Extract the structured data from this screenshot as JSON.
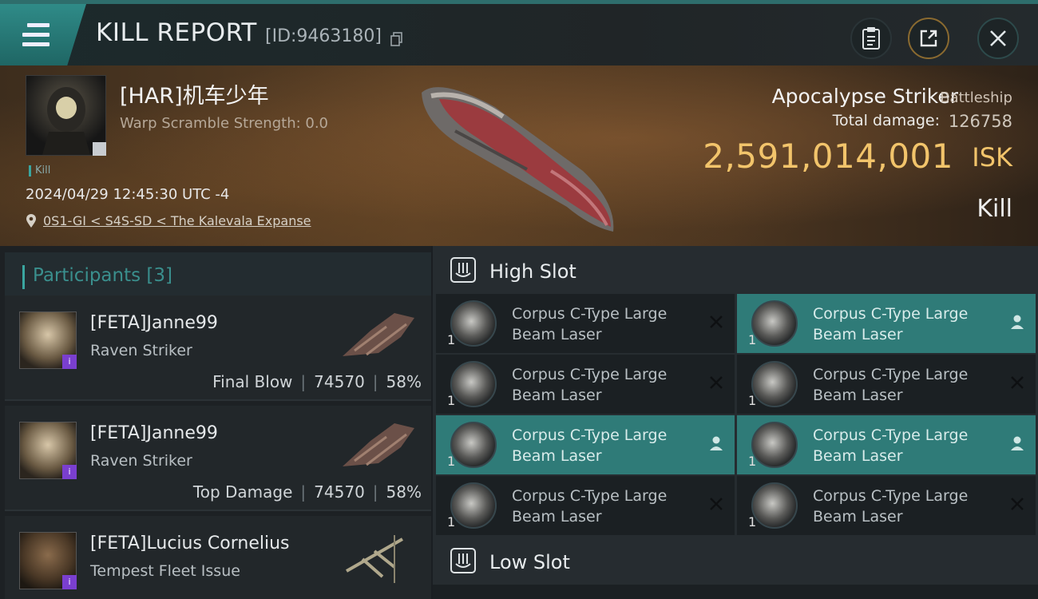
{
  "header": {
    "title": "KILL REPORT",
    "report_id": "[ID:9463180]",
    "icons": [
      "menu-icon",
      "copy-icon",
      "clipboard-icon",
      "share-icon",
      "close-icon"
    ]
  },
  "victim": {
    "name": "[HAR]机车少年",
    "warp_scramble": "Warp Scramble Strength: 0.0",
    "tag": "Kill",
    "datetime": "2024/04/29 12:45:30 UTC -4",
    "location": "0S1-GI < S4S-SD < The Kalevala Expanse",
    "ship_name": "Apocalypse Striker",
    "ship_class": "Battleship",
    "total_damage_label": "Total damage:",
    "total_damage": "126758",
    "isk_value": "2,591,014,001",
    "isk_unit": "ISK",
    "status": "Kill"
  },
  "participants": {
    "label": "Participants [3]",
    "rows": [
      {
        "name": "[FETA]Janne99",
        "ship": "Raven Striker",
        "role": "Final Blow",
        "damage": "74570",
        "percent": "58%"
      },
      {
        "name": "[FETA]Janne99",
        "ship": "Raven Striker",
        "role": "Top Damage",
        "damage": "74570",
        "percent": "58%"
      },
      {
        "name": "[FETA]Lucius Cornelius",
        "ship": "Tempest Fleet Issue",
        "role": "",
        "damage": "",
        "percent": ""
      }
    ]
  },
  "slots": {
    "high_label": "High Slot",
    "low_label": "Low Slot",
    "modules": [
      {
        "line1": "Corpus C-Type Large",
        "line2": "Beam Laser",
        "qty": "1",
        "state": "destroyed"
      },
      {
        "line1": "Corpus C-Type Large",
        "line2": "Beam Laser",
        "qty": "1",
        "state": "dropped"
      },
      {
        "line1": "Corpus C-Type Large",
        "line2": "Beam Laser",
        "qty": "1",
        "state": "destroyed"
      },
      {
        "line1": "Corpus C-Type Large",
        "line2": "Beam Laser",
        "qty": "1",
        "state": "destroyed"
      },
      {
        "line1": "Corpus C-Type Large",
        "line2": "Beam Laser",
        "qty": "1",
        "state": "dropped"
      },
      {
        "line1": "Corpus C-Type Large",
        "line2": "Beam Laser",
        "qty": "1",
        "state": "dropped"
      },
      {
        "line1": "Corpus C-Type Large",
        "line2": "Beam Laser",
        "qty": "1",
        "state": "destroyed"
      },
      {
        "line1": "Corpus C-Type Large",
        "line2": "Beam Laser",
        "qty": "1",
        "state": "destroyed"
      }
    ]
  },
  "colors": {
    "accent": "#3aa6a0",
    "isk": "#f2c46b",
    "active_slot": "#2f7b78"
  }
}
